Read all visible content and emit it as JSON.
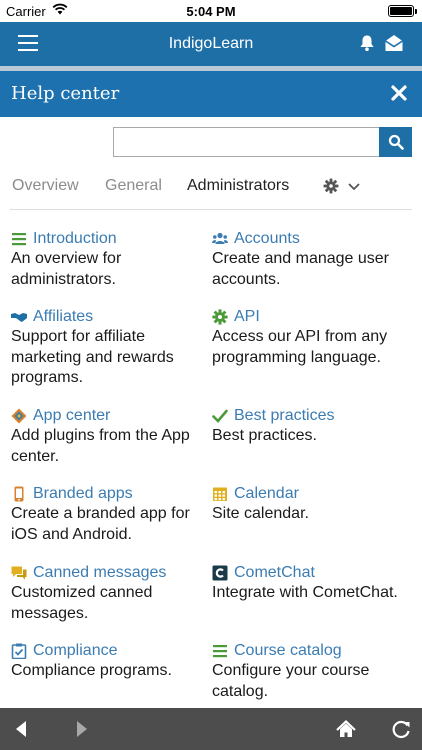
{
  "status_bar": {
    "carrier": "Carrier",
    "time": "5:04 PM",
    "battery_level": 1.0
  },
  "app_header": {
    "title": "IndigoLearn",
    "icons": [
      "hamburger-menu-icon",
      "bell-icon",
      "envelope-open-icon"
    ]
  },
  "help_bar": {
    "title": "Help center",
    "close_icon": "close-icon"
  },
  "search": {
    "value": "",
    "placeholder": "",
    "button_icon": "search-icon"
  },
  "tabs": {
    "overview": "Overview",
    "general": "General",
    "administrators": "Administrators",
    "active": "Administrators",
    "settings_icon": "gear-icon",
    "dropdown_icon": "chevron-down-icon"
  },
  "items": [
    {
      "title": "Introduction",
      "desc": "An overview for administrators.",
      "icon": "list-icon",
      "color": "#4a9a3a"
    },
    {
      "title": "Accounts",
      "desc": "Create and manage user accounts.",
      "icon": "users-icon",
      "color": "#3b7cb3"
    },
    {
      "title": "Affiliates",
      "desc": "Support for affiliate marketing and rewards programs.",
      "icon": "handshake-icon",
      "color": "#1f6fa7"
    },
    {
      "title": "API",
      "desc": "Access our API from any programming language.",
      "icon": "cog-icon",
      "color": "#4a9a3a"
    },
    {
      "title": "App center",
      "desc": "Add plugins from the App center.",
      "icon": "app-center-icon",
      "color": "#d9822b"
    },
    {
      "title": "Best practices",
      "desc": "Best practices.",
      "icon": "check-icon",
      "color": "#4a9a3a"
    },
    {
      "title": "Branded apps",
      "desc": "Create a branded app for iOS and Android.",
      "icon": "phone-icon",
      "color": "#d9822b"
    },
    {
      "title": "Calendar",
      "desc": "Site calendar.",
      "icon": "calendar-icon",
      "color": "#e0b020"
    },
    {
      "title": "Canned messages",
      "desc": "Customized canned messages.",
      "icon": "chat-icon",
      "color": "#e0b020"
    },
    {
      "title": "CometChat",
      "desc": "Integrate with CometChat.",
      "icon": "cometchat-icon",
      "color": "#1a3a4a"
    },
    {
      "title": "Compliance",
      "desc": "Compliance programs.",
      "icon": "clipboard-check-icon",
      "color": "#3b7cb3"
    },
    {
      "title": "Course catalog",
      "desc": "Configure your course catalog.",
      "icon": "list-icon",
      "color": "#4a9a3a"
    }
  ],
  "bottom_bar": {
    "icons": [
      "back-arrow-icon",
      "forward-arrow-icon",
      "home-icon",
      "reload-icon"
    ]
  },
  "colors": {
    "header_blue": "#1f6fa7",
    "link_blue": "#3b7cb3",
    "toolbar_gray": "#4d4d4d"
  }
}
